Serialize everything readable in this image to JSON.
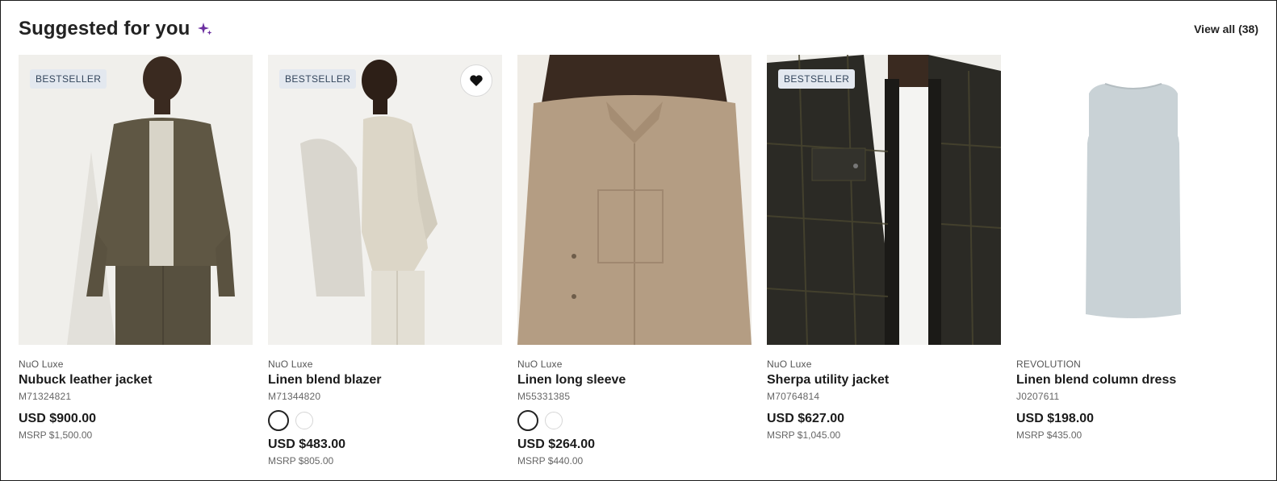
{
  "header": {
    "title": "Suggested for you",
    "sparkle_icon": "sparkle-icon",
    "view_all_label": "View all (38)",
    "accent_color": "#6b2fa0"
  },
  "products": [
    {
      "badge": "BESTSELLER",
      "brand": "NuO Luxe",
      "name": "Nubuck leather jacket",
      "sku": "M71324821",
      "price": "USD $900.00",
      "msrp": "MSRP $1,500.00",
      "image_icon": "product-photo-leather-jacket"
    },
    {
      "badge": "BESTSELLER",
      "brand": "NuO Luxe",
      "name": "Linen blend blazer",
      "sku": "M71344820",
      "price": "USD $483.00",
      "msrp": "MSRP $805.00",
      "favorite_icon": "heart-icon",
      "swatch_count": 2,
      "image_icon": "product-photo-linen-blazer"
    },
    {
      "brand": "NuO Luxe",
      "name": "Linen long sleeve",
      "sku": "M55331385",
      "price": "USD $264.00",
      "msrp": "MSRP $440.00",
      "swatch_count": 2,
      "image_icon": "product-photo-linen-shirt"
    },
    {
      "badge": "BESTSELLER",
      "brand": "NuO Luxe",
      "name": "Sherpa utility jacket",
      "sku": "M70764814",
      "price": "USD $627.00",
      "msrp": "MSRP $1,045.00",
      "image_icon": "product-photo-plaid-jacket"
    },
    {
      "brand": "REVOLUTION",
      "name": "Linen blend column dress",
      "sku": "J0207611",
      "price": "USD $198.00",
      "msrp": "MSRP $435.00",
      "image_icon": "product-photo-column-dress"
    }
  ]
}
